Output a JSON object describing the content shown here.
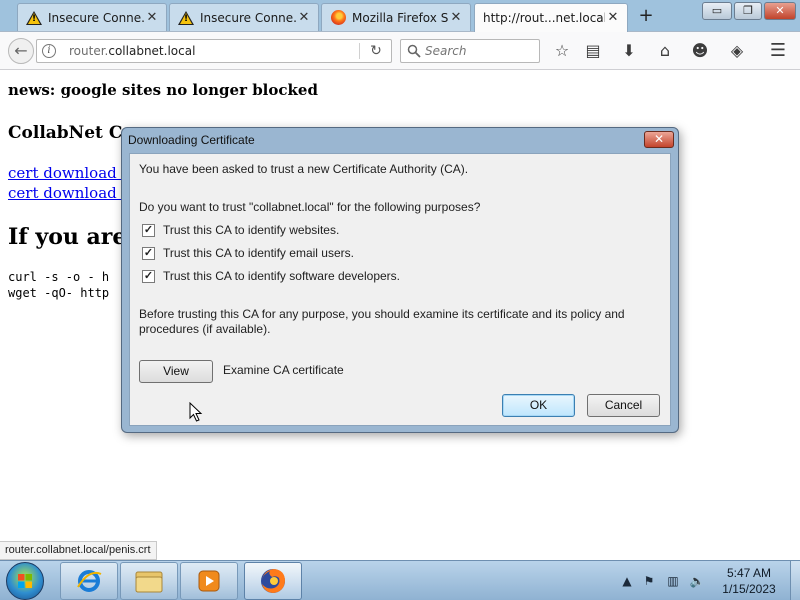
{
  "browser": {
    "tabs": [
      {
        "title": "Insecure Conne...",
        "icon": "warning-icon"
      },
      {
        "title": "Insecure Conne...",
        "icon": "warning-icon"
      },
      {
        "title": "Mozilla Firefox S...",
        "icon": "firefox-icon"
      },
      {
        "title": "http://rout...net.local/",
        "icon": "none",
        "active": true
      }
    ],
    "new_tab_glyph": "+",
    "window_controls": {
      "minimize": "▭",
      "restore": "❐",
      "close": "✕"
    },
    "url": {
      "prefix": "router.",
      "host": "collabnet.local"
    },
    "search_placeholder": "Search",
    "accent_color": "#0000ee"
  },
  "page": {
    "news": "news: google sites no longer blocked",
    "cert_heading": "CollabNet Cer",
    "links": [
      "cert download (DE",
      "cert download (PE"
    ],
    "big_heading": "If you are c",
    "code_lines": [
      "curl -s -o - h",
      "wget -qO- http"
    ],
    "status_url": "router.collabnet.local/penis.crt"
  },
  "dialog": {
    "title": "Downloading Certificate",
    "intro": "You have been asked to trust a new Certificate Authority (CA).",
    "question": "Do you want to trust \"collabnet.local\" for the following purposes?",
    "options": [
      {
        "label": "Trust this CA to identify websites.",
        "checked": true
      },
      {
        "label": "Trust this CA to identify email users.",
        "checked": true
      },
      {
        "label": "Trust this CA to identify software developers.",
        "checked": true
      }
    ],
    "advice_line1": "Before trusting this CA for any purpose, you should examine its certificate and its policy and",
    "advice_line2": "procedures (if available).",
    "view_label": "View",
    "examine_label": "Examine CA certificate",
    "ok_label": "OK",
    "cancel_label": "Cancel"
  },
  "taskbar": {
    "time": "5:47 AM",
    "date": "1/15/2023",
    "pinned": [
      "internet-explorer-icon",
      "file-explorer-icon",
      "media-player-icon",
      "firefox-icon"
    ]
  }
}
